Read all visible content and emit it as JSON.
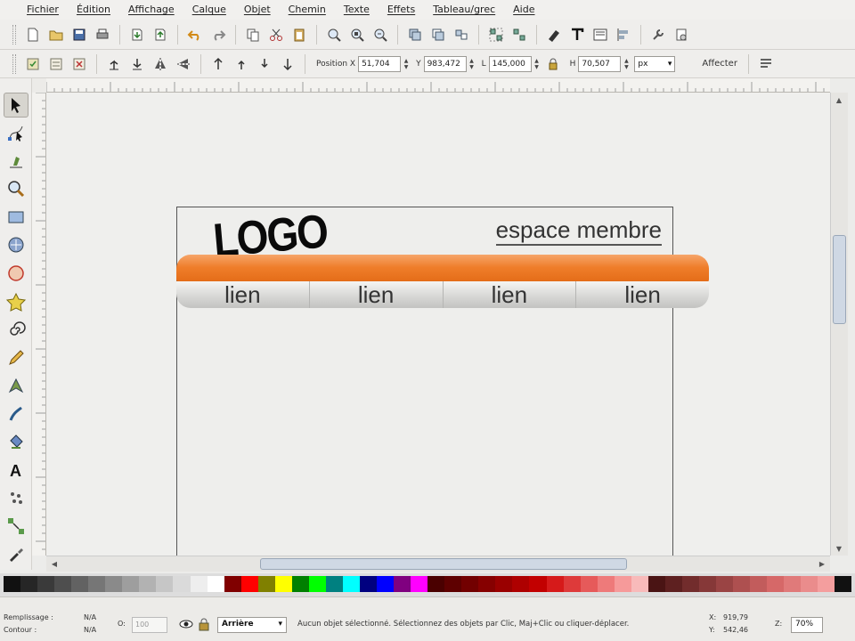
{
  "menubar": {
    "items": [
      "Fichier",
      "Édition",
      "Affichage",
      "Calque",
      "Objet",
      "Chemin",
      "Texte",
      "Effets",
      "Tableau/grec",
      "Aide"
    ]
  },
  "controls": {
    "position_x_label": "Position X",
    "x_value": "51,704",
    "y_label": "Y",
    "y_value": "983,472",
    "w_label": "L",
    "w_value": "145,000",
    "h_label": "H",
    "h_value": "70,507",
    "unit": "px",
    "apply_label": "Affecter"
  },
  "canvas": {
    "logo_text": "LOGO",
    "member_text": "espace membre",
    "nav_links": [
      "lien",
      "lien",
      "lien",
      "lien"
    ]
  },
  "palette": {
    "colors": [
      "#111111",
      "#262626",
      "#3a3a3a",
      "#4e4e4e",
      "#626262",
      "#767676",
      "#8a8a8a",
      "#9e9e9e",
      "#b2b2b2",
      "#c6c6c6",
      "#dadada",
      "#eeeeee",
      "#ffffff",
      "#800000",
      "#ff0000",
      "#808000",
      "#ffff00",
      "#008000",
      "#00ff00",
      "#008080",
      "#00ffff",
      "#000080",
      "#0000ff",
      "#800080",
      "#ff00ff",
      "#4a0000",
      "#5e0000",
      "#720000",
      "#860000",
      "#9a0000",
      "#ae0000",
      "#c20000",
      "#d61a1a",
      "#de3a3a",
      "#e65a5a",
      "#ee7a7a",
      "#f69a9a",
      "#f8baba",
      "#4a1414",
      "#5e2020",
      "#722c2c",
      "#863838",
      "#9a4444",
      "#ae5050",
      "#c25c5c",
      "#d66868",
      "#e07a7a",
      "#ea8c8c",
      "#f49e9e",
      "#111111"
    ]
  },
  "status": {
    "fill_label": "Remplissage :",
    "fill_value": "N/A",
    "stroke_label": "Contour :",
    "stroke_value": "N/A",
    "opacity_label": "O:",
    "opacity_value": "100",
    "layer": "Arrière",
    "message": "Aucun objet sélectionné. Sélectionnez des objets par Clic, Maj+Clic ou cliquer-déplacer.",
    "x_label": "X:",
    "x_value": "919,79",
    "y_label": "Y:",
    "y_value": "542,46",
    "zoom_label": "Z:",
    "zoom_value": "70%"
  }
}
